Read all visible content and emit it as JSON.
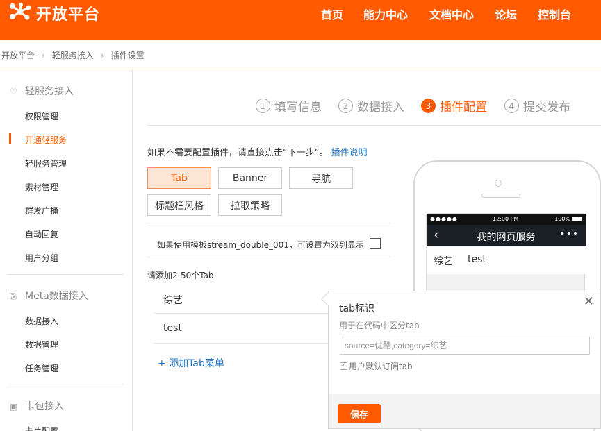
{
  "header": {
    "logo_icon": "molecule-logo-icon",
    "logo_text": "开放平台",
    "brand_color": "#ff5a00",
    "nav": [
      "首页",
      "能力中心",
      "文档中心",
      "论坛",
      "控制台"
    ]
  },
  "breadcrumb": [
    "开放平台",
    "轻服务接入",
    "插件设置"
  ],
  "sidebar": {
    "groups": [
      {
        "icon": "heart-icon",
        "label": "轻服务接入",
        "items": [
          "权限管理",
          "开通轻服务",
          "轻服务管理",
          "素材管理",
          "群发广播",
          "自动回复",
          "用户分组"
        ]
      },
      {
        "icon": "import-icon",
        "label": "Meta数据接入",
        "items": [
          "数据接入",
          "数据管理",
          "任务管理"
        ]
      },
      {
        "icon": "card-icon",
        "label": "卡包接入",
        "items": [
          "卡片配置"
        ]
      }
    ],
    "active_item": "开通轻服务"
  },
  "steps": [
    {
      "num": "1",
      "label": "填写信息",
      "active": false
    },
    {
      "num": "2",
      "label": "数据接入",
      "active": false
    },
    {
      "num": "3",
      "label": "插件配置",
      "active": true
    },
    {
      "num": "4",
      "label": "提交发布",
      "active": false
    }
  ],
  "hint": {
    "text": "如果不需要配置插件，请直接点击“下一步”。",
    "link": "插件说明"
  },
  "plugin_options": [
    "Tab",
    "Banner",
    "导航",
    "标题栏风格",
    "拉取策略"
  ],
  "selected_option": "Tab",
  "double_column": {
    "label": "如果使用模板stream_double_001，可设置为双列显示",
    "checked": false
  },
  "tabs_section": {
    "hint": "请添加2-50个Tab",
    "tabs": [
      "综艺",
      "test"
    ],
    "add_label": "+ 添加Tab菜单"
  },
  "phone_preview": {
    "carrier_dots": "●●●●●",
    "time": "12:00 PM",
    "battery": "100%",
    "title": "我的网页服务",
    "back_icon": "chevron-left-icon",
    "more_icon": "ellipsis-icon",
    "tabs": [
      "综艺",
      "test"
    ]
  },
  "popover": {
    "title": "tab标识",
    "description": "用于在代码中区分tab",
    "input_value": "",
    "input_placeholder": "source=优酷,category=综艺",
    "checkbox_label": "用户默认订阅tab",
    "checkbox_checked": true,
    "save_label": "保存",
    "close_icon": "close-icon"
  }
}
